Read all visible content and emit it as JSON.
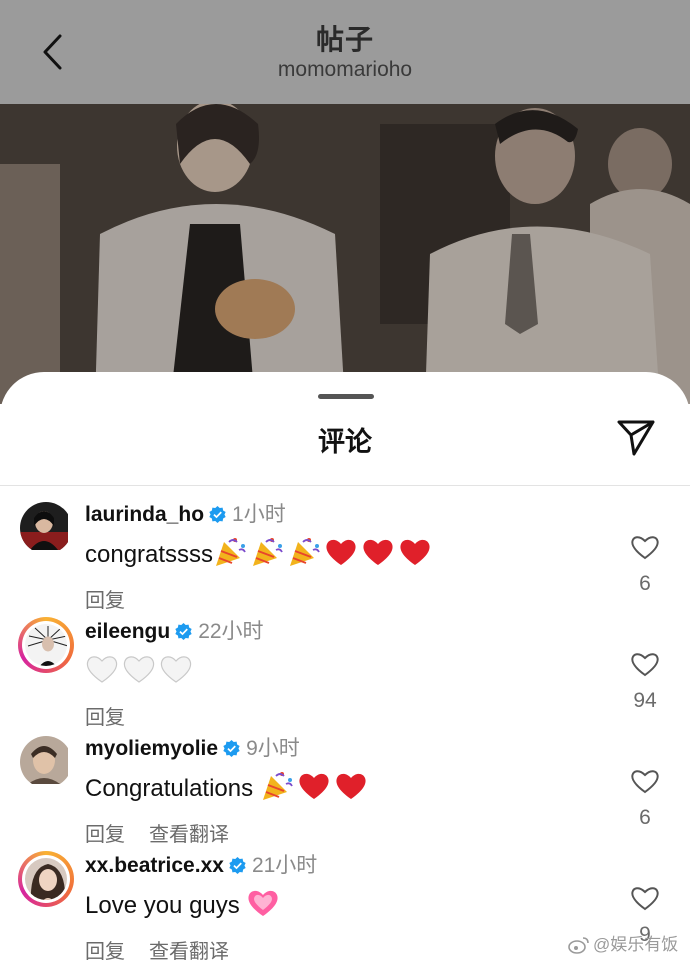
{
  "header": {
    "title": "帖子",
    "username": "momomarioho"
  },
  "sheet": {
    "title": "评论"
  },
  "comments": [
    {
      "username": "laurinda_ho",
      "time": "1小时",
      "text": "congratssss",
      "emojis": [
        "party-popper",
        "party-popper",
        "party-popper",
        "red-heart",
        "red-heart",
        "red-heart"
      ],
      "actions": [
        "回复"
      ],
      "likes": "6",
      "story_ring": false
    },
    {
      "username": "eileengu",
      "time": "22小时",
      "text": "",
      "emojis": [
        "white-heart",
        "white-heart",
        "white-heart"
      ],
      "actions": [
        "回复"
      ],
      "likes": "94",
      "story_ring": true
    },
    {
      "username": "myoliemyolie",
      "time": "9小时",
      "text": "Congratulations",
      "emojis": [
        "party-popper",
        "red-heart",
        "red-heart"
      ],
      "actions": [
        "回复",
        "查看翻译"
      ],
      "likes": "6",
      "story_ring": false
    },
    {
      "username": "xx.beatrice.xx",
      "time": "21小时",
      "text": "Love you guys",
      "emojis": [
        "pink-heart"
      ],
      "actions": [
        "回复",
        "查看翻译"
      ],
      "likes": "9",
      "story_ring": true
    }
  ],
  "watermark": "@娱乐有饭",
  "colors": {
    "verified": "#1d9bf0",
    "red_heart": "#e0202a",
    "pink_heart": "#ff5fa2",
    "story_ring": "#d6249f"
  }
}
